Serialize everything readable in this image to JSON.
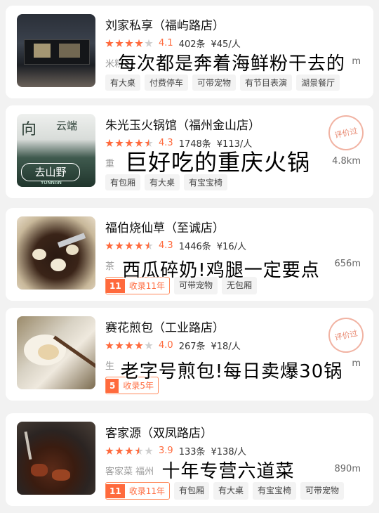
{
  "restaurants": [
    {
      "name": "刘家私享（福屿路店）",
      "score": "4.1",
      "reviews": "402条",
      "price": "¥45/人",
      "sub": "米粉",
      "distance": "m",
      "tags": [
        "有大桌",
        "付费停车",
        "可带宠物",
        "有节目表演",
        "湖景餐厅"
      ],
      "caption": "每次都是奔着海鲜粉干去的"
    },
    {
      "name": "朱光玉火锅馆（福州金山店）",
      "score": "4.3",
      "reviews": "1748条",
      "price": "¥113/人",
      "sub": "重",
      "distance": "4.8km",
      "tags": [
        "有包厢",
        "有大桌",
        "有宝宝椅"
      ],
      "stamp": "评价过",
      "caption": "巨好吃的重庆火锅"
    },
    {
      "name": "福伯烧仙草（至诚店）",
      "score": "4.3",
      "reviews": "1446条",
      "price": "¥16/人",
      "sub": "茶",
      "distance": "656m",
      "collect_years": "11",
      "collect_label": "收录11年",
      "tags": [
        "可带宠物",
        "无包厢"
      ],
      "caption": "西瓜碎奶!鸡腿一定要点"
    },
    {
      "name": "赛花煎包（工业路店）",
      "score": "4.0",
      "reviews": "267条",
      "price": "¥18/人",
      "sub": "生",
      "distance": "m",
      "collect_years": "5",
      "collect_label": "收录5年",
      "tags": [],
      "stamp": "评价过",
      "caption": "老字号煎包!每日卖爆30锅"
    },
    {
      "name": "客家源（双凤路店）",
      "score": "3.9",
      "reviews": "133条",
      "price": "¥138/人",
      "sub": "客家菜  福州",
      "distance": "890m",
      "collect_years": "11",
      "collect_label": "收录11年",
      "tags": [
        "有包厢",
        "有大桌",
        "有宝宝椅",
        "可带宠物"
      ],
      "caption": "十年专营六道菜"
    }
  ],
  "thumb_texts": {
    "r2_top": "向",
    "r2_mid": "云端",
    "r2_bottom": "去山野",
    "r2_brand": "YUNNAN"
  }
}
